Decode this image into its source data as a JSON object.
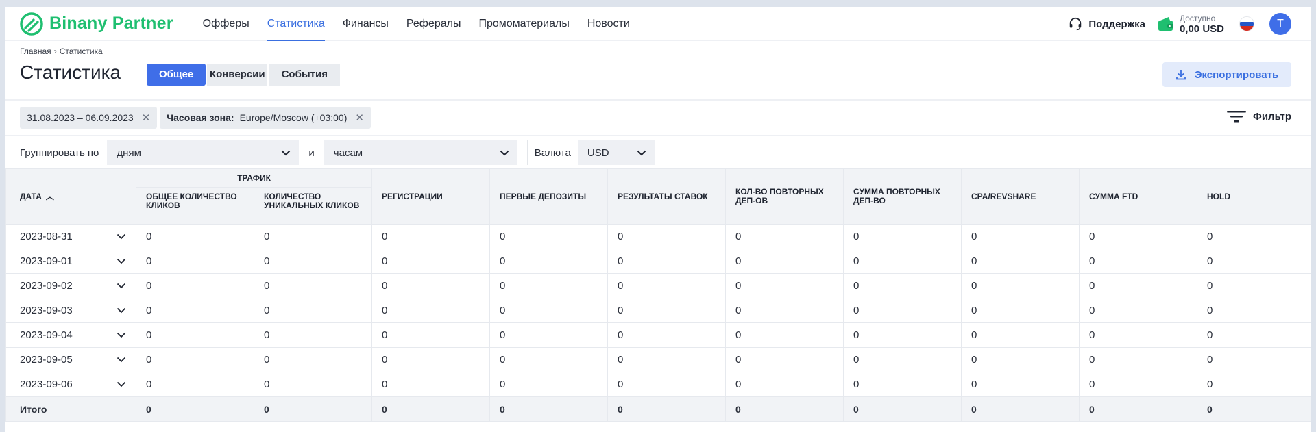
{
  "brand": {
    "name": "Binany Partner",
    "color": "#1fbf70"
  },
  "nav": {
    "items": [
      {
        "label": "Офферы",
        "active": false
      },
      {
        "label": "Статистика",
        "active": true
      },
      {
        "label": "Финансы",
        "active": false
      },
      {
        "label": "Рефералы",
        "active": false
      },
      {
        "label": "Промоматериалы",
        "active": false
      },
      {
        "label": "Новости",
        "active": false
      }
    ],
    "support_label": "Поддержка",
    "balance_label": "Доступно",
    "balance_value": "0,00 USD",
    "avatar_initial": "T",
    "accent": "#3f6ee8"
  },
  "breadcrumb": {
    "home": "Главная",
    "current": "Статистика"
  },
  "page": {
    "title": "Статистика",
    "tabs": [
      "Общее",
      "Конверсии",
      "События"
    ],
    "export_label": "Экспортировать"
  },
  "filters": {
    "date_range": "31.08.2023 – 06.09.2023",
    "timezone_label": "Часовая зона:",
    "timezone_value": "Europe/Moscow (+03:00)",
    "filter_label": "Фильтр"
  },
  "grouping": {
    "label": "Группировать по",
    "primary": "дням",
    "and_label": "и",
    "secondary": "часам",
    "currency_label": "Валюта",
    "currency": "USD"
  },
  "table": {
    "date_header": "Дата",
    "traffic_group": "Трафик",
    "traffic_cols": [
      "Общее количество кликов",
      "Количество уникальных кликов"
    ],
    "other_cols": [
      "Регистрации",
      "Первые депозиты",
      "Результаты ставок",
      "Кол-во повторных деп-ов",
      "Сумма повторных деп-во",
      "CPA/RevShare",
      "Сумма FTD",
      "Hold"
    ],
    "rows": [
      {
        "date": "2023-08-31",
        "values": [
          "0",
          "0",
          "0",
          "0",
          "0",
          "0",
          "0",
          "0",
          "0",
          "0"
        ]
      },
      {
        "date": "2023-09-01",
        "values": [
          "0",
          "0",
          "0",
          "0",
          "0",
          "0",
          "0",
          "0",
          "0",
          "0"
        ]
      },
      {
        "date": "2023-09-02",
        "values": [
          "0",
          "0",
          "0",
          "0",
          "0",
          "0",
          "0",
          "0",
          "0",
          "0"
        ]
      },
      {
        "date": "2023-09-03",
        "values": [
          "0",
          "0",
          "0",
          "0",
          "0",
          "0",
          "0",
          "0",
          "0",
          "0"
        ]
      },
      {
        "date": "2023-09-04",
        "values": [
          "0",
          "0",
          "0",
          "0",
          "0",
          "0",
          "0",
          "0",
          "0",
          "0"
        ]
      },
      {
        "date": "2023-09-05",
        "values": [
          "0",
          "0",
          "0",
          "0",
          "0",
          "0",
          "0",
          "0",
          "0",
          "0"
        ]
      },
      {
        "date": "2023-09-06",
        "values": [
          "0",
          "0",
          "0",
          "0",
          "0",
          "0",
          "0",
          "0",
          "0",
          "0"
        ]
      }
    ],
    "total_label": "Итого",
    "totals": [
      "0",
      "0",
      "0",
      "0",
      "0",
      "0",
      "0",
      "0",
      "0",
      "0"
    ]
  }
}
